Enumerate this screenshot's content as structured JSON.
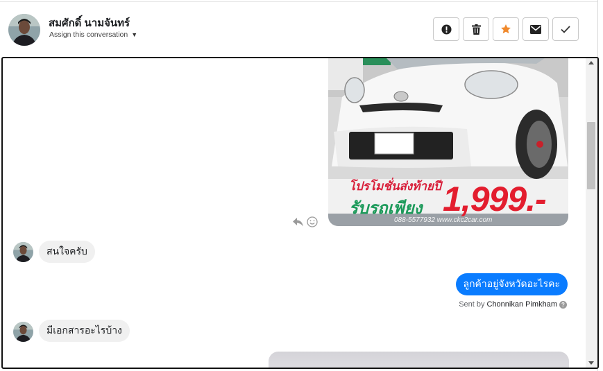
{
  "header": {
    "contact_name": "สมศักดิ์ นามจันทร์",
    "assign_label": "Assign this conversation",
    "actions": [
      {
        "name": "mark-spam-button",
        "icon": "exclamation-circle-icon"
      },
      {
        "name": "delete-button",
        "icon": "trash-icon"
      },
      {
        "name": "star-button",
        "icon": "star-icon",
        "color": "#f0892c"
      },
      {
        "name": "mark-unread-button",
        "icon": "envelope-icon"
      },
      {
        "name": "mark-done-button",
        "icon": "checkmark-icon"
      }
    ]
  },
  "conversation": {
    "car_image": {
      "promo_line1": "โปรโมชั่นส่งท้ายปี",
      "promo_line2": "รับรถเพียง",
      "price": "1,999.-",
      "contact": "088-5577932  www.ckc2car.com"
    },
    "messages": [
      {
        "direction": "in",
        "text": "สนใจครับ"
      },
      {
        "direction": "out",
        "text": "ลูกค้าอยู่จังหวัดอะไรคะ"
      },
      {
        "direction": "in",
        "text": "มีเอกสารอะไรบ้าง"
      }
    ],
    "sent_by_prefix": "Sent by",
    "sent_by_agent": "Chonnikan Pimkham"
  },
  "colors": {
    "accent": "#0a7cff",
    "star": "#f0892c",
    "incoming_bubble": "#f0f0f0"
  }
}
